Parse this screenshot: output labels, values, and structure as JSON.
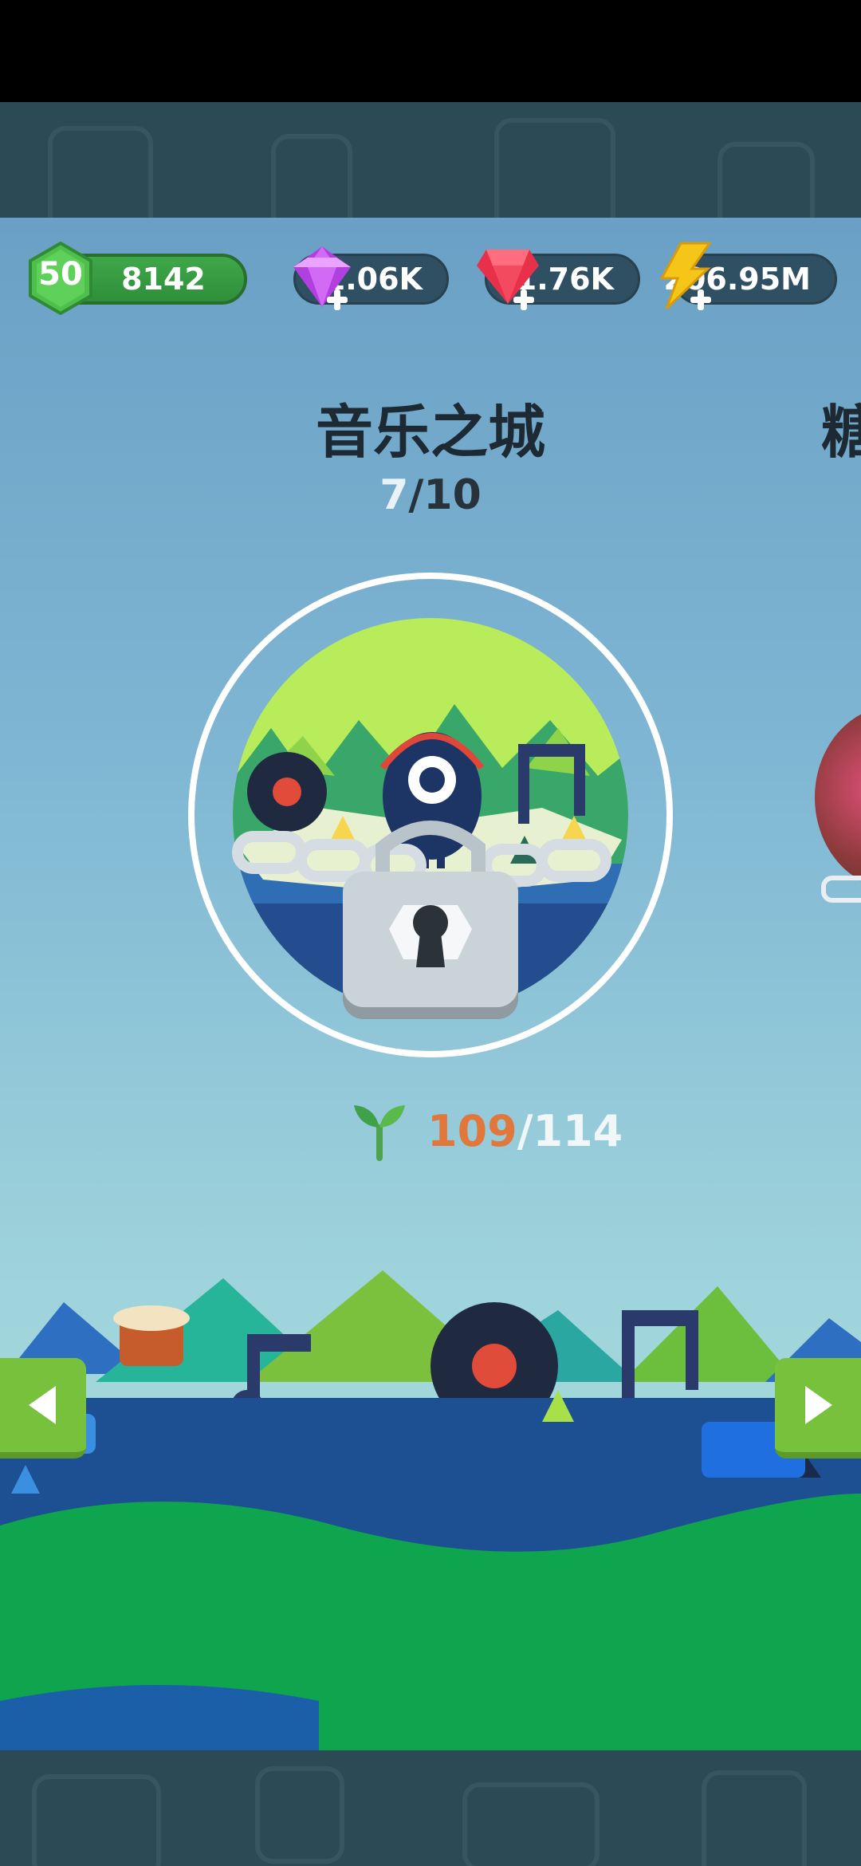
{
  "hud": {
    "level": "50",
    "experience": "8142",
    "purple_gems": "1.06K",
    "red_gems": "1.76K",
    "energy": "206.95M"
  },
  "world": {
    "title": "音乐之城",
    "next_title": "糖",
    "progress_current": "7",
    "progress_total": "/10",
    "sprouts_current": "109",
    "sprouts_total": "/114"
  },
  "colors": {
    "level_green": "#3fa74a",
    "purple_gem": "#b23fe0",
    "red_gem": "#e8304a",
    "energy_yellow": "#f5c518",
    "sprout_current": "#e2773c",
    "nav_button": "#78c13d",
    "sea_blue": "#1d4f93",
    "grass_green": "#0fa44e"
  },
  "icons": {
    "level": "hexagon-badge-icon",
    "purple_gems": "purple-gem-icon",
    "red_gems": "red-gem-icon",
    "energy": "lightning-icon",
    "lock": "padlock-icon",
    "sprout": "sprout-icon",
    "prev": "triangle-left-icon",
    "next": "triangle-right-icon"
  }
}
